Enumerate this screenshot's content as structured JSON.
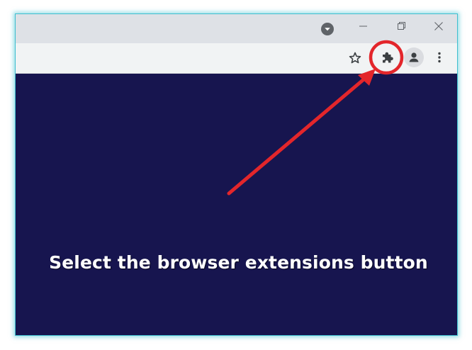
{
  "browser": {
    "window_controls": {
      "tab_search_icon": "tab-search-icon",
      "minimize_icon": "minimize-icon",
      "restore_icon": "restore-icon",
      "close_icon": "close-icon"
    },
    "toolbar": {
      "bookmark_icon": "star-icon",
      "extensions_icon": "puzzle-piece-icon",
      "profile_icon": "person-icon",
      "menu_icon": "kebab-menu-icon"
    }
  },
  "annotation": {
    "caption": "Select the browser extensions button",
    "highlight_color": "#e3262b",
    "target": "extensions-button"
  },
  "colors": {
    "content_background": "#17154f",
    "frame_border": "#3fbfcf",
    "titlebar": "#dee1e6",
    "toolbar": "#f1f3f4",
    "icon": "#5f6368"
  }
}
